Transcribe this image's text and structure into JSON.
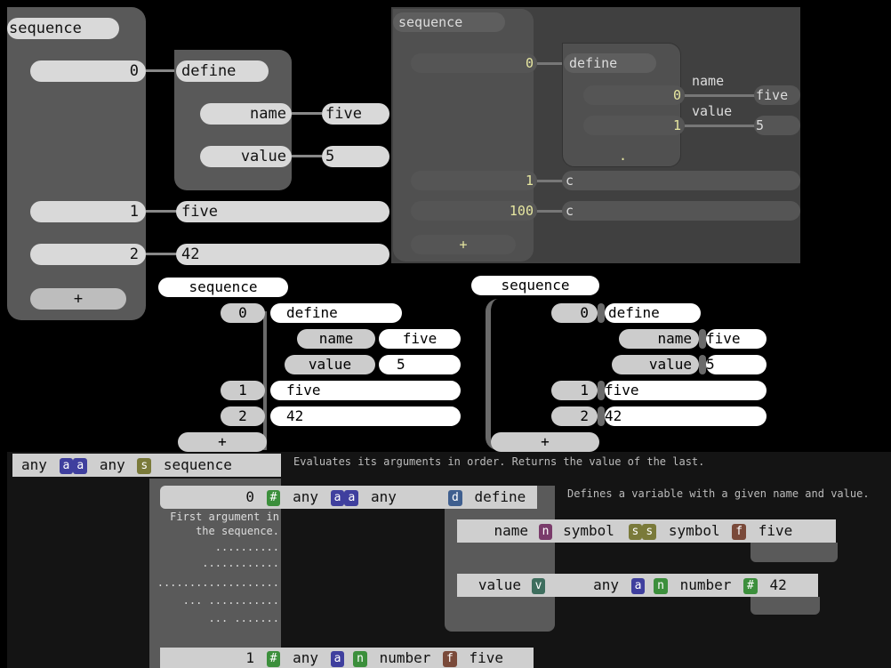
{
  "panel1": {
    "title": "sequence",
    "items": [
      {
        "index": "0",
        "node": "define"
      },
      {
        "index": "1",
        "node": "five"
      },
      {
        "index": "2",
        "node": "42"
      }
    ],
    "define_args": [
      {
        "label": "name",
        "value": "five"
      },
      {
        "label": "value",
        "value": "5"
      }
    ],
    "add": "+"
  },
  "panel2": {
    "title": "sequence",
    "item0": {
      "index": "0",
      "node": "define"
    },
    "define_args": [
      {
        "index": "0",
        "label": "name",
        "value": "five"
      },
      {
        "index": "1",
        "label": "value",
        "value": "5"
      }
    ],
    "dot": ".",
    "item1": {
      "index": "1",
      "node": "c"
    },
    "item2": {
      "index": "100",
      "node": "c"
    },
    "add": "+"
  },
  "panel3": {
    "title": "sequence",
    "items": [
      {
        "index": "0",
        "node": "define"
      },
      {
        "index": "1",
        "node": "five"
      },
      {
        "index": "2",
        "node": "42"
      }
    ],
    "define_args": [
      {
        "label": "name",
        "value": "five"
      },
      {
        "label": "value",
        "value": "5"
      }
    ],
    "add": "+"
  },
  "panel4": {
    "title": "sequence",
    "items": [
      {
        "index": "0",
        "node": "define"
      },
      {
        "index": "1",
        "node": "five"
      },
      {
        "index": "2",
        "node": "42"
      }
    ],
    "define_args": [
      {
        "label": "name",
        "value": "five"
      },
      {
        "label": "value",
        "value": "5"
      }
    ],
    "add": "+"
  },
  "panel5": {
    "header": {
      "t1": "any",
      "g1": "a",
      "g2": "a",
      "t2": "any",
      "g3": "s",
      "t3": "sequence"
    },
    "seq_desc": "Evaluates its arguments in order. Returns the value of the last.",
    "arg0": {
      "index": "0",
      "g0": "#",
      "t1": "any",
      "g1": "a",
      "g2": "a",
      "t2": "any"
    },
    "arg0_desc_line1": "First argument in",
    "arg0_desc_line2": "the sequence.",
    "dots": [
      "..........",
      "............",
      "...................",
      "... ...........",
      "... ......."
    ],
    "define": {
      "g": "d",
      "label": "define",
      "desc": "Defines a variable with a given name and value."
    },
    "name_row": {
      "label": "name",
      "g1": "n",
      "t1": "symbol",
      "g2": "s",
      "g3": "s",
      "t2": "symbol",
      "g4": "f",
      "val": "five"
    },
    "value_row": {
      "label": "value",
      "g1": "v",
      "t1": "any",
      "g2": "a",
      "g3": "n",
      "t2": "number",
      "g4": "#",
      "val": "42"
    },
    "arg1": {
      "index": "1",
      "g0": "#",
      "t1": "any",
      "g1": "a",
      "g2": "n",
      "t2": "number",
      "g3": "f",
      "val": "five"
    }
  },
  "colors": {
    "tag_a": "#3f3f9e",
    "tag_s": "#7a7a3a",
    "tag_hash": "#3c8f3c",
    "tag_n": "#7a3b6b",
    "tag_f": "#7a4a3a",
    "tag_d": "#3f5f8f",
    "tag_v": "#3e6e5e"
  }
}
